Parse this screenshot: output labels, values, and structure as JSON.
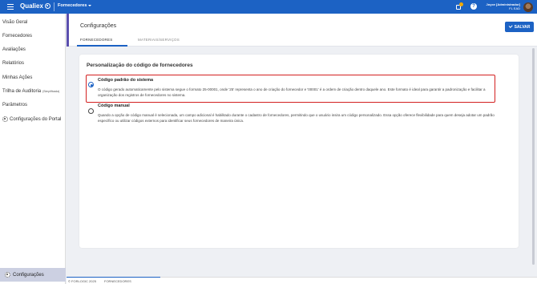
{
  "topbar": {
    "brand": "Qualiex",
    "module": "Fornecedores",
    "user_name": "Joyce [Administrador]",
    "user_company": "FL EAD",
    "help_icon": "?"
  },
  "sidebar": {
    "items": [
      {
        "label": "Visão Geral"
      },
      {
        "label": "Fornecedores"
      },
      {
        "label": "Avaliações"
      },
      {
        "label": "Relatórios"
      },
      {
        "label": "Minhas Ações"
      },
      {
        "label": "Trilha de Auditoria",
        "badge": "(Simplificada)"
      },
      {
        "label": "Parâmetros"
      },
      {
        "label": "Configurações do Portal",
        "icon": "gear-icon"
      }
    ],
    "bottom_label": "Configurações"
  },
  "page": {
    "title": "Configurações",
    "tabs": [
      {
        "label": "FORNECEDORES",
        "active": true
      },
      {
        "label": "MATERIAIS/SERVIÇOS",
        "active": false
      }
    ],
    "save_label": "SALVAR"
  },
  "card": {
    "title": "Personalização do código de fornecedores",
    "options": [
      {
        "title": "Código padrão do sistema",
        "desc": "O código gerado automaticamente pelo sistema segue o formato 25-00001, onde '25' representa o ano de criação do fornecedor e '00001' é a ordem de criação dentro daquele ano. Este formato é ideal para garantir a padronização e facilitar a organização dos registros de fornecedores no sistema.",
        "selected": true
      },
      {
        "title": "Código manual",
        "desc": "Quando a opção de código manual é selecionada, um campo adicional é habilitado durante o cadastro de fornecedores, permitindo que o usuário insira um código personalizado. Essa opção oferece flexibilidade para quem deseja adotar um padrão específico ou utilizar códigos externos para identificar seus fornecedores de maneira única.",
        "selected": false
      }
    ]
  },
  "footer": {
    "copyright": "© FORLOGIC 2025",
    "module": "FORNECEDORES"
  },
  "colors": {
    "primary": "#1c62c4",
    "accent": "#5b4fae",
    "highlight": "#d32020",
    "badge": "#f2a900"
  }
}
